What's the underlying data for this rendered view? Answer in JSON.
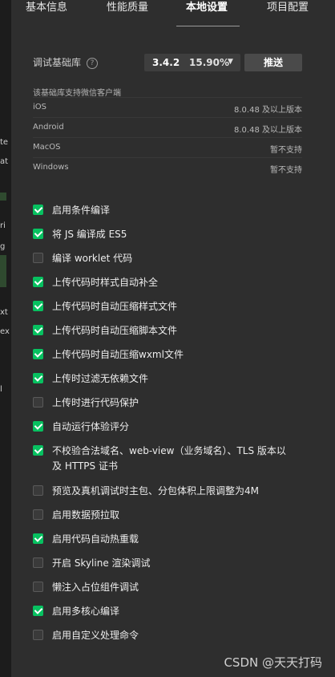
{
  "tabs": [
    {
      "label": "基本信息"
    },
    {
      "label": "性能质量"
    },
    {
      "label": "本地设置"
    },
    {
      "label": "项目配置"
    }
  ],
  "active_tab": "本地设置",
  "base_library": {
    "label": "调试基础库",
    "version": "3.4.2",
    "percentage": "15.90%",
    "push_label": "推送"
  },
  "support": {
    "title": "该基础库支持微信客户端",
    "rows": [
      {
        "os": "iOS",
        "status": "8.0.48 及以上版本"
      },
      {
        "os": "Android",
        "status": "8.0.48 及以上版本"
      },
      {
        "os": "MacOS",
        "status": "暂不支持"
      },
      {
        "os": "Windows",
        "status": "暂不支持"
      }
    ]
  },
  "options": [
    {
      "label": "启用条件编译",
      "checked": true
    },
    {
      "label": "将 JS 编译成 ES5",
      "checked": true
    },
    {
      "label": "编译 worklet 代码",
      "checked": false
    },
    {
      "label": "上传代码时样式自动补全",
      "checked": true
    },
    {
      "label": "上传代码时自动压缩样式文件",
      "checked": true
    },
    {
      "label": "上传代码时自动压缩脚本文件",
      "checked": true
    },
    {
      "label": "上传代码时自动压缩wxml文件",
      "checked": true
    },
    {
      "label": "上传时过滤无依赖文件",
      "checked": true
    },
    {
      "label": "上传时进行代码保护",
      "checked": false
    },
    {
      "label": "自动运行体验评分",
      "checked": true
    },
    {
      "label": "不校验合法域名、web-view（业务域名）、TLS 版本以及 HTTPS 证书",
      "checked": true
    },
    {
      "label": "预览及真机调试时主包、分包体积上限调整为4M",
      "checked": false
    },
    {
      "label": "启用数据预拉取",
      "checked": false
    },
    {
      "label": "启用代码自动热重载",
      "checked": true
    },
    {
      "label": "开启 Skyline 渲染调试",
      "checked": false
    },
    {
      "label": "懒注入占位组件调试",
      "checked": false
    },
    {
      "label": "启用多核心编译",
      "checked": true
    },
    {
      "label": "启用自定义处理命令",
      "checked": false
    }
  ],
  "left_fragments": [
    "te",
    "at",
    "ri",
    "g",
    "xt",
    "ex",
    "l"
  ],
  "watermark": "CSDN @天天打码",
  "colors": {
    "accent": "#07c160",
    "background": "#2e2e2e"
  }
}
